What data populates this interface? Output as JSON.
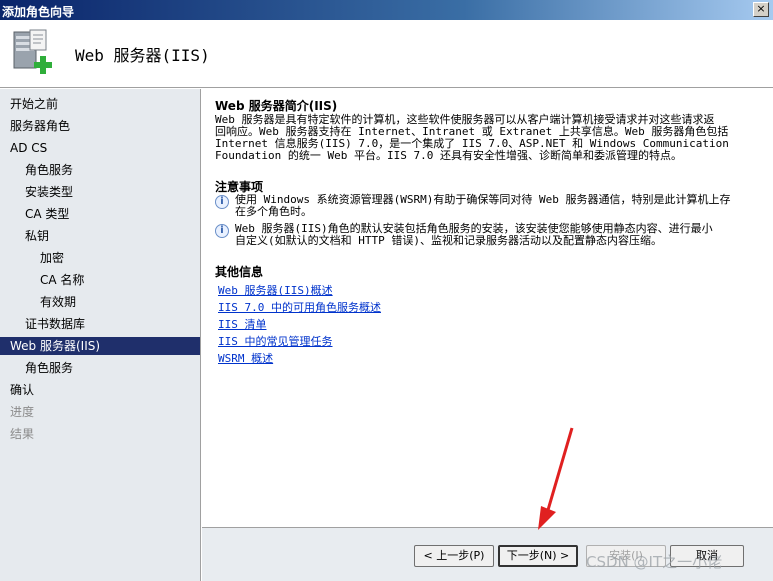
{
  "window": {
    "title": "添加角色向导",
    "close_glyph": "×"
  },
  "header": {
    "title": "Web 服务器(IIS)",
    "icon": "server-add-icon"
  },
  "nav": {
    "items": [
      {
        "label": "开始之前",
        "indent": 0,
        "state": "normal"
      },
      {
        "label": "服务器角色",
        "indent": 0,
        "state": "normal"
      },
      {
        "label": "AD CS",
        "indent": 0,
        "state": "normal"
      },
      {
        "label": "角色服务",
        "indent": 1,
        "state": "normal"
      },
      {
        "label": "安装类型",
        "indent": 1,
        "state": "normal"
      },
      {
        "label": "CA 类型",
        "indent": 1,
        "state": "normal"
      },
      {
        "label": "私钥",
        "indent": 1,
        "state": "normal"
      },
      {
        "label": "加密",
        "indent": 2,
        "state": "normal"
      },
      {
        "label": "CA 名称",
        "indent": 2,
        "state": "normal"
      },
      {
        "label": "有效期",
        "indent": 2,
        "state": "normal"
      },
      {
        "label": "证书数据库",
        "indent": 1,
        "state": "normal"
      },
      {
        "label": "Web 服务器(IIS)",
        "indent": 0,
        "state": "active"
      },
      {
        "label": "角色服务",
        "indent": 1,
        "state": "normal"
      },
      {
        "label": "确认",
        "indent": 0,
        "state": "normal"
      },
      {
        "label": "进度",
        "indent": 0,
        "state": "disabled"
      },
      {
        "label": "结果",
        "indent": 0,
        "state": "disabled"
      }
    ]
  },
  "main": {
    "intro_title": "Web 服务器简介(IIS)",
    "intro_lines": [
      "Web 服务器是具有特定软件的计算机，这些软件使服务器可以从客户端计算机接受请求并对这些请求返",
      "回响应。Web 服务器支持在 Internet、Intranet 或 Extranet 上共享信息。Web 服务器角色包括",
      "Internet 信息服务(IIS) 7.0，是一个集成了 IIS 7.0、ASP.NET 和 Windows Communication",
      "Foundation 的统一 Web 平台。IIS 7.0 还具有安全性增强、诊断简单和委派管理的特点。"
    ],
    "notes_title": "注意事项",
    "notes": [
      {
        "icon": "info-icon",
        "lines": [
          "使用 Windows 系统资源管理器(WSRM)有助于确保等同对待 Web 服务器通信，特别是此计算机上存",
          "在多个角色时。"
        ]
      },
      {
        "icon": "info-icon",
        "lines": [
          "Web 服务器(IIS)角色的默认安装包括角色服务的安装，该安装使您能够使用静态内容、进行最小",
          "自定义(如默认的文档和 HTTP 错误)、监视和记录服务器活动以及配置静态内容压缩。"
        ]
      }
    ],
    "more_title": "其他信息",
    "links": [
      "Web 服务器(IIS)概述",
      "IIS 7.0 中的可用角色服务概述",
      "IIS 清单",
      "IIS 中的常见管理任务",
      "WSRM 概述"
    ]
  },
  "footer": {
    "back_label": "< 上一步(P)",
    "next_label": "下一步(N) >",
    "install_label": "安装(I)",
    "cancel_label": "取消"
  },
  "watermark": "CSDN @IT之一小佬",
  "colors": {
    "active_nav": "#1f2f6b",
    "link": "#0033cc",
    "arrow": "#e02020"
  }
}
